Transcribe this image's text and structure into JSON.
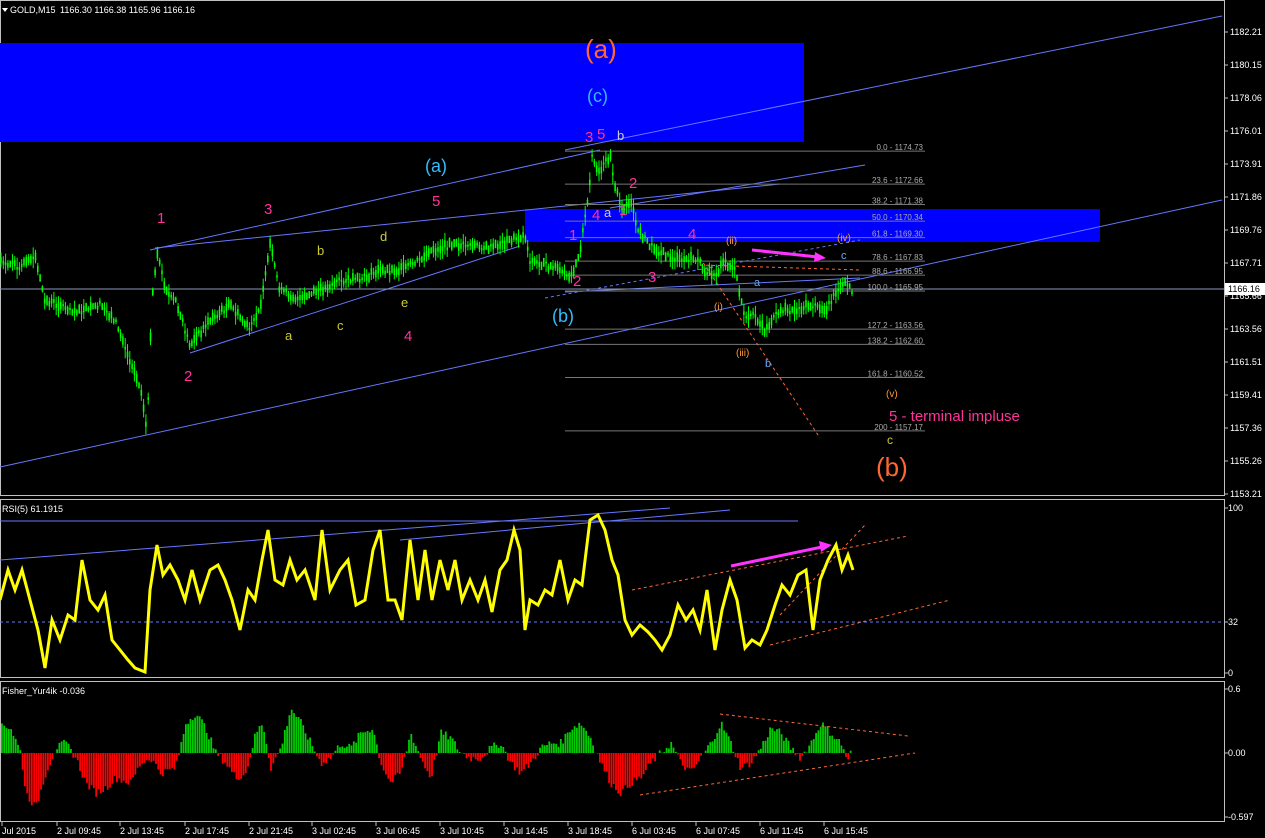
{
  "header": {
    "arrow_icon": "triangle-down-icon",
    "symbol": "GOLD,M15",
    "quote": "1166.30 1166.38 1165.96 1166.16"
  },
  "colors": {
    "background": "#000000",
    "bull_candle": "#00ff00",
    "wave_magenta": "#ff3399",
    "wave_cyan": "#33bbff",
    "wave_orange": "#ff6633",
    "zone_blue": "#0000ff",
    "rsi_line": "#ffff00",
    "fisher_pos": "#00cc00",
    "fisher_neg": "#ff0000",
    "arrow": "#ff33ff"
  },
  "price_axis": {
    "ticks": [
      "1182.21",
      "1180.15",
      "1178.06",
      "1176.01",
      "1173.91",
      "1171.86",
      "1169.76",
      "1167.71",
      "1165.66",
      "1163.56",
      "1161.51",
      "1159.41",
      "1157.36",
      "1155.26",
      "1153.21"
    ],
    "current_price": "1166.16"
  },
  "fib_levels": [
    {
      "label": "0.0 - 1174.73",
      "value": 1174.73
    },
    {
      "label": "23.6 - 1172.66",
      "value": 1172.66
    },
    {
      "label": "38.2 - 1171.38",
      "value": 1171.38
    },
    {
      "label": "50.0 - 1170.34",
      "value": 1170.34
    },
    {
      "label": "61.8 - 1169.30",
      "value": 1169.3
    },
    {
      "label": "78.6 - 1167.83",
      "value": 1167.83
    },
    {
      "label": "88.6 - 1166.95",
      "value": 1166.95
    },
    {
      "label": "100.0 - 1165.95",
      "value": 1165.95
    },
    {
      "label": "127.2 - 1163.56",
      "value": 1163.56
    },
    {
      "label": "138.2 - 1162.60",
      "value": 1162.6
    },
    {
      "label": "161.8 - 1160.52",
      "value": 1160.52
    },
    {
      "label": "200 - 1157.17",
      "value": 1157.17
    }
  ],
  "wave_labels": {
    "big_a": "(a)",
    "big_b": "(b)",
    "big_c": "(c)",
    "mid_a": "(a)",
    "mid_b": "(b)",
    "n1": "1",
    "n2": "2",
    "n3": "3",
    "n4": "4",
    "n5": "5",
    "la": "a",
    "lb": "b",
    "lc": "c",
    "ld": "d",
    "le": "e",
    "r1": "1",
    "r2": "2",
    "r3": "3",
    "r4": "4",
    "r5": "5",
    "s35_3": "3",
    "s35_5": "5",
    "sb": "b",
    "sa": "a",
    "s4": "4",
    "s1": "1",
    "s2": "2",
    "sub_1": "1",
    "sub_2": "2",
    "sub_3": "3",
    "sub_4": "4",
    "ri": "(i)",
    "rii": "(ii)",
    "riii": "(iii)",
    "riv": "(iv)",
    "rv": "(v)",
    "ba": "a",
    "bb": "b",
    "bc": "c",
    "gc": "c",
    "terminal": "5 - terminal impluse"
  },
  "rsi": {
    "title": "RSI(5) 61.1915",
    "axis": [
      "100",
      "32",
      "0"
    ]
  },
  "fisher": {
    "title": "Fisher_Yur4ik -0.036",
    "axis": [
      "0.6",
      "0.00",
      "-0.597"
    ]
  },
  "time_axis": [
    "Jul 2015",
    "2 Jul 09:45",
    "2 Jul 13:45",
    "2 Jul 17:45",
    "2 Jul 21:45",
    "3 Jul 02:45",
    "3 Jul 06:45",
    "3 Jul 10:45",
    "3 Jul 14:45",
    "3 Jul 18:45",
    "6 Jul 03:45",
    "6 Jul 07:45",
    "6 Jul 11:45",
    "6 Jul 15:45"
  ]
}
